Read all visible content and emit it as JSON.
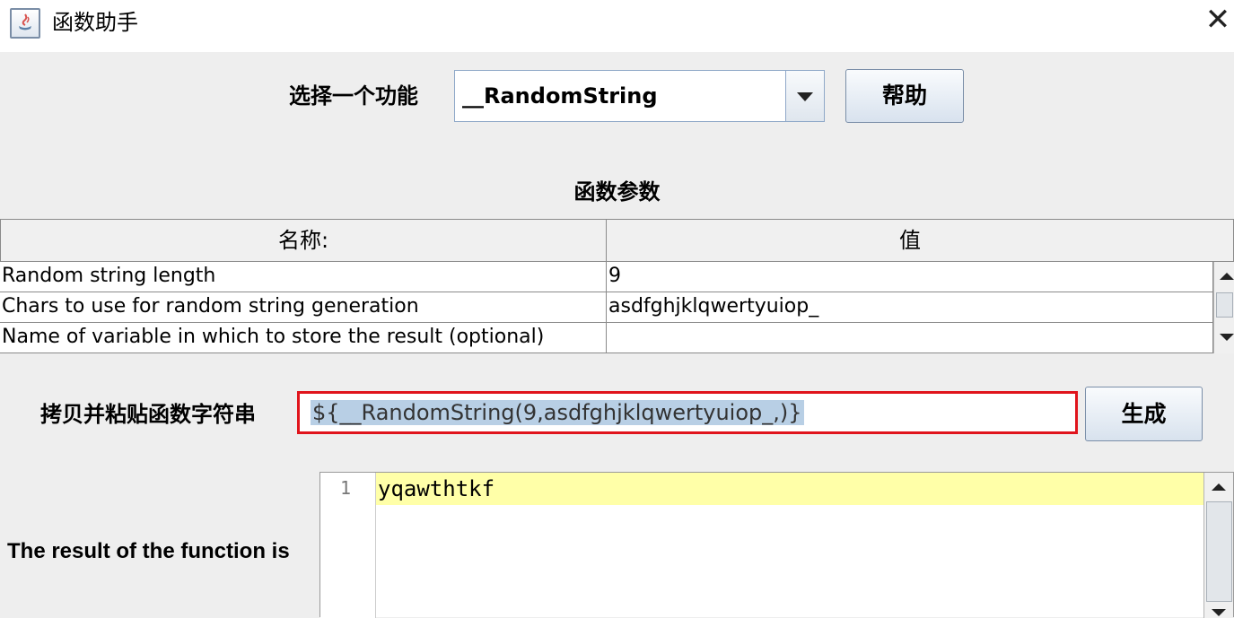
{
  "window": {
    "title": "函数助手",
    "close_glyph": "✕"
  },
  "function_select": {
    "label": "选择一个功能",
    "selected": "__RandomString",
    "help_button": "帮助"
  },
  "params": {
    "section_title": "函数参数",
    "columns": [
      "名称:",
      "值"
    ],
    "rows": [
      {
        "name": "Random string length",
        "value": "9"
      },
      {
        "name": "Chars to use for random string generation",
        "value": "asdfghjklqwertyuiop_"
      },
      {
        "name": "Name of variable in which to store the result (optional)",
        "value": ""
      }
    ]
  },
  "copy_paste": {
    "label": "拷贝并粘贴函数字符串",
    "value": "${__RandomString(9,asdfghjklqwertyuiop_,)}",
    "generate_button": "生成",
    "highlight_color": "#e0141c"
  },
  "result": {
    "label": "The result of the function is",
    "line_number": "1",
    "text": "yqawthtkf",
    "line_highlight_color": "#ffffa8"
  }
}
